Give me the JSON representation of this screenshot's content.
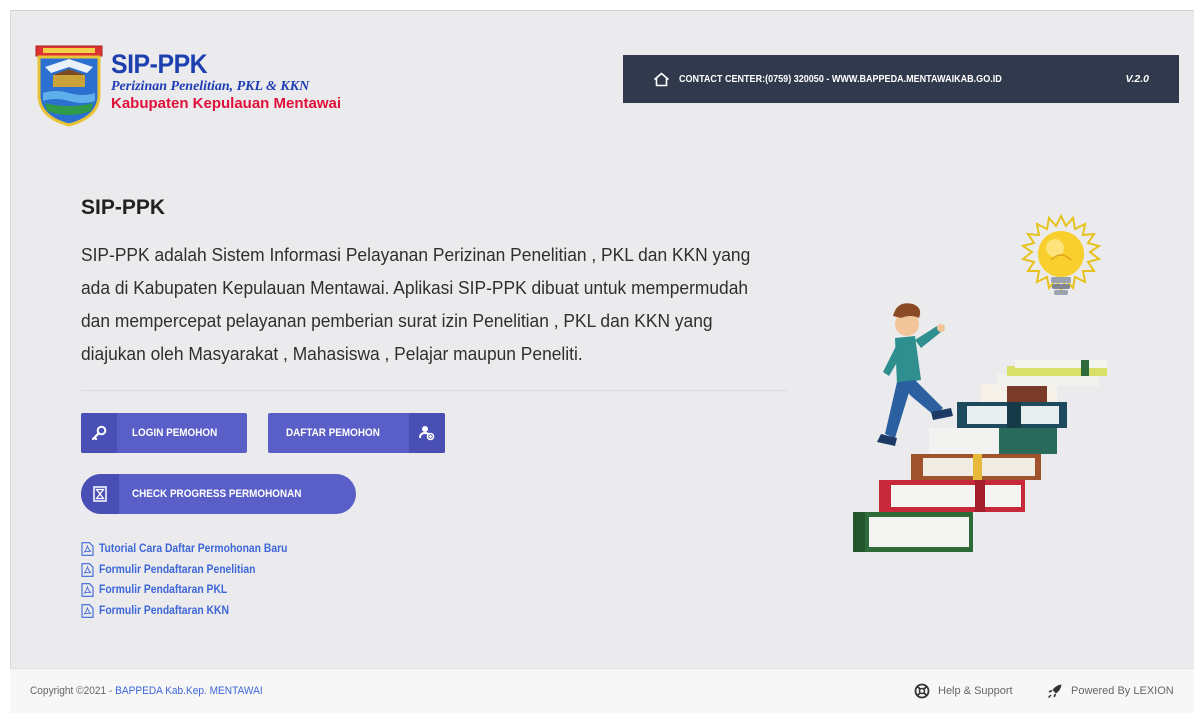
{
  "header": {
    "brand_title": "SIP-PPK",
    "brand_subtitle": "Perizinan Penelitian, PKL & KKN",
    "brand_region": "Kabupaten Kepulauan Mentawai",
    "contact_text": "CONTACT CENTER:(0759) 320050 - WWW.BAPPEDA.MENTAWAIKAB.GO.ID",
    "version": "V.2.0"
  },
  "main": {
    "title": "SIP-PPK",
    "description": "SIP-PPK adalah Sistem Informasi Pelayanan Perizinan Penelitian , PKL dan KKN yang ada di Kabupaten Kepulauan Mentawai. Aplikasi SIP-PPK dibuat untuk mempermudah dan mempercepat pelayanan pemberian surat izin Penelitian , PKL dan KKN yang diajukan oleh Masyarakat , Mahasiswa , Pelajar maupun Peneliti.",
    "buttons": {
      "login": "LOGIN PEMOHON",
      "daftar": "DAFTAR PEMOHON",
      "check": "CHECK PROGRESS PERMOHONAN"
    },
    "links": [
      "Tutorial Cara Daftar Permohonan Baru",
      "Formulir Pendaftaran Penelitian",
      "Formulir Pendaftaran PKL",
      "Formulir Pendaftaran KKN"
    ]
  },
  "footer": {
    "copyright_prefix": "Copyright ©2021 - ",
    "copyright_org": "BAPPEDA Kab.Kep. MENTAWAI",
    "help": "Help & Support",
    "powered": "Powered By LEXION"
  },
  "colors": {
    "primary_button": "#5a5fc7",
    "contact_bar": "#313a4c",
    "brand_blue": "#1d3fb0",
    "brand_red": "#e0103a",
    "link": "#3d66d8"
  },
  "icons": [
    "regency-emblem-icon",
    "home-icon",
    "key-icon",
    "user-add-icon",
    "hourglass-icon",
    "pdf-icon",
    "lifebuoy-icon",
    "rocket-icon"
  ]
}
